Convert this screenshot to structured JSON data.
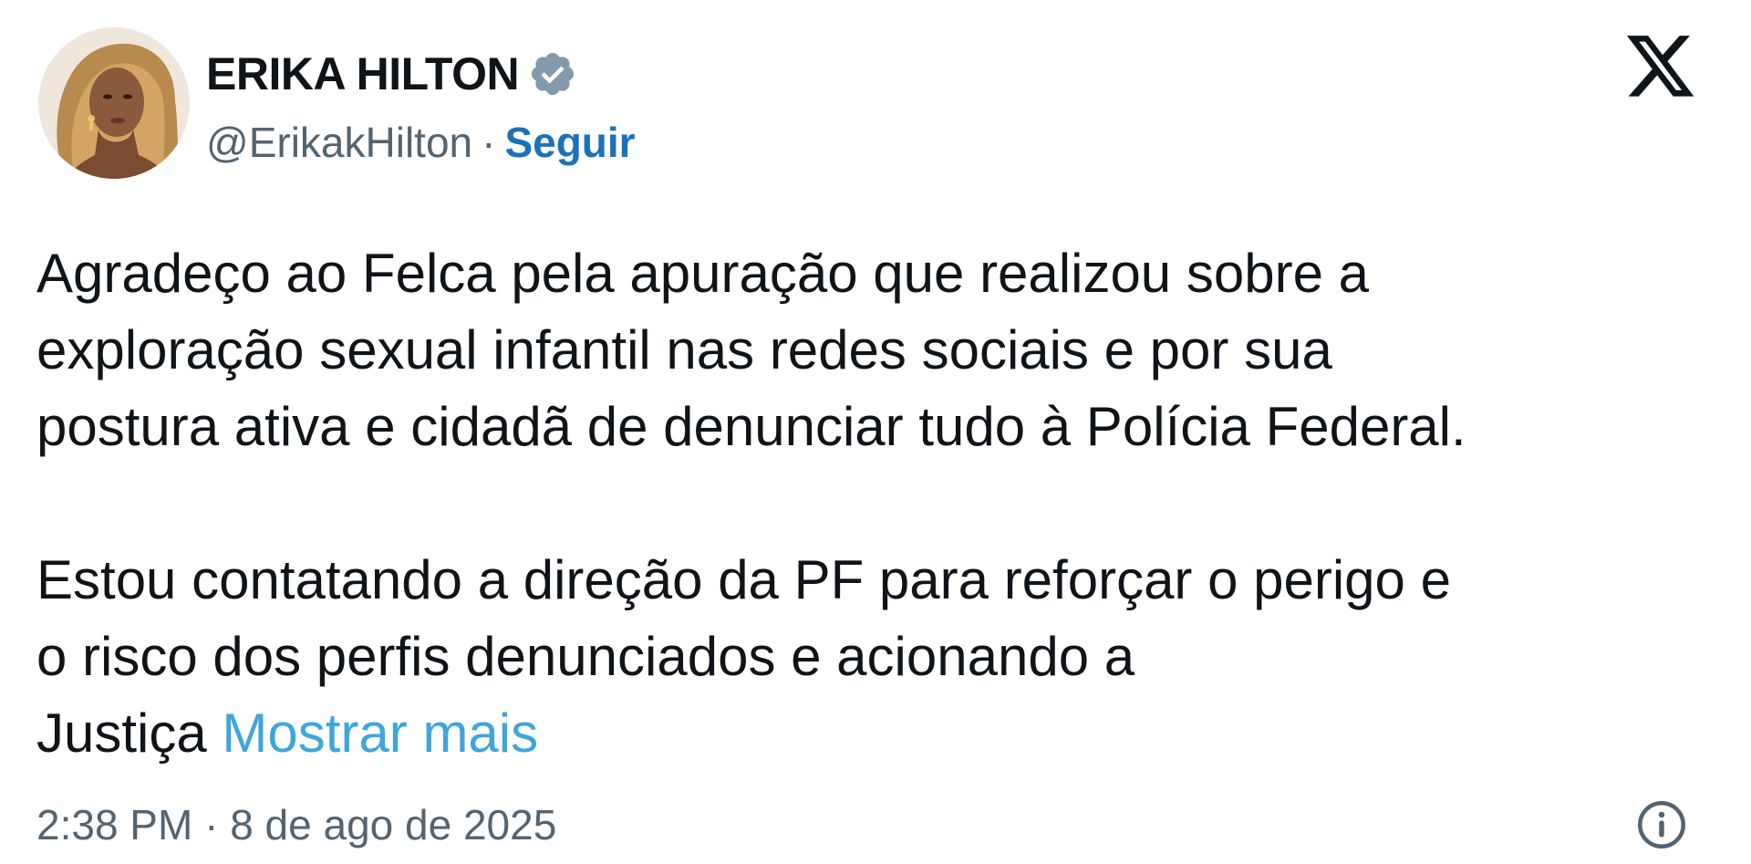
{
  "author": {
    "name": "ERIKA HILTON",
    "handle": "@ErikakHilton",
    "separator": "·",
    "follow_label": "Seguir",
    "verified_icon": "verified-badge-icon",
    "avatar_icon": "profile-avatar"
  },
  "platform": {
    "logo_icon": "x-logo-icon"
  },
  "tweet": {
    "paragraph_1": "Agradeço ao Felca pela apuração que realizou sobre a\nexploração sexual infantil nas redes sociais e por sua\npostura ativa e cidadã de denunciar tudo à Polícia Federal.",
    "paragraph_2": "Estou contatando a direção da PF para reforçar o perigo e\no risco dos perfis denunciados e acionando a\nJustiça",
    "show_more_label": "Mostrar mais"
  },
  "footer": {
    "timestamp": "2:38 PM · 8 de ago de 2025",
    "info_icon": "info-icon"
  },
  "colors": {
    "text": "#0f1419",
    "secondary": "#536471",
    "follow_link": "#1d71b8",
    "show_more": "#3ea6db",
    "verified": "#829aab"
  }
}
